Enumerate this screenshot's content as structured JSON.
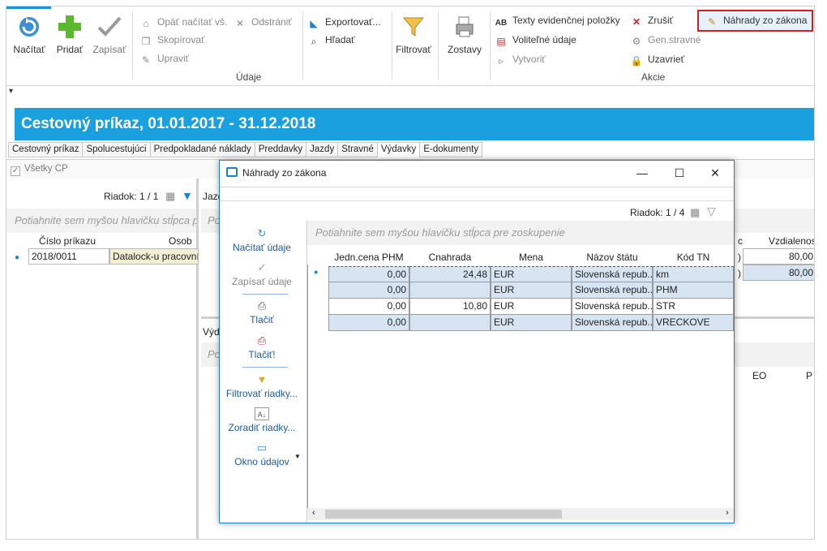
{
  "ribbon": {
    "big_buttons": [
      {
        "label": "Načítať",
        "icon": "reload-icon"
      },
      {
        "label": "Pridať",
        "icon": "add-icon"
      },
      {
        "label": "Zapísať",
        "icon": "check-icon"
      }
    ],
    "data_small": [
      {
        "label": "Opäť načítať vš.",
        "icon": "home-reload-icon",
        "disabled": true
      },
      {
        "label": "Skopírovať",
        "icon": "copy-icon",
        "disabled": true
      },
      {
        "label": "Upraviť",
        "icon": "edit-icon",
        "disabled": true
      },
      {
        "label": "Odstrániť",
        "icon": "delete-icon",
        "disabled": true
      },
      {
        "label": "Exportovať...",
        "icon": "export-icon"
      },
      {
        "label": "Hľadať",
        "icon": "search-icon"
      }
    ],
    "filter_label": "Filtrovať",
    "reports_label": "Zostavy",
    "group_data": "Údaje",
    "actions_small": [
      {
        "label": "Texty evidenčnej položky",
        "icon": "text-ab-icon"
      },
      {
        "label": "Voliteľné údaje",
        "icon": "form-icon"
      },
      {
        "label": "Vytvoriť",
        "icon": "create-icon",
        "disabled": true
      },
      {
        "label": "Zrušiť",
        "icon": "cancel-x-icon"
      },
      {
        "label": "Gen.stravné",
        "icon": "gears-icon",
        "disabled": true
      },
      {
        "label": "Uzavrieť",
        "icon": "lock-icon"
      },
      {
        "label": "Náhrady zo zákona",
        "icon": "pencil-note-icon"
      }
    ],
    "group_actions": "Akcie"
  },
  "quickbar": "▾",
  "page_title": "Cestovný príkaz, 01.01.2017 - 31.12.2018",
  "tabs": [
    "Cestovný príkaz",
    "Spolucestujúci",
    "Predpokladané náklady",
    "Preddavky",
    "Jazdy",
    "Stravné",
    "Výdavky",
    "E-dokumenty"
  ],
  "active_tab": "Výdavky",
  "filter_checkbox": "Všetky CP",
  "left_grid": {
    "riadok": "Riadok: 1 / 1",
    "group_hint": "Potiahnite sem myšou hlavičku stĺpca pre zoskupenie",
    "columns": [
      "Číslo príkazu",
      "Osob"
    ],
    "rows": [
      [
        "2018/0011",
        "Datalock-u pracovník"
      ]
    ]
  },
  "right_bg": {
    "col_partial": "Jazd",
    "hint_partial": "Po",
    "vyd_partial": "Výd",
    "hint_partial2": "Po",
    "header_c": "c",
    "header_vzd": "Vzdialenosť",
    "vzd_values": [
      "80,00",
      "80,00"
    ],
    "paren": ")",
    "eo": "EO",
    "p": "P"
  },
  "dialog": {
    "title": "Náhrady zo zákona",
    "minimize": "—",
    "maximize": "☐",
    "close": "✕",
    "riadok": "Riadok: 1 / 4",
    "side_buttons": [
      {
        "label": "Načítať údaje",
        "icon": "reload-icon"
      },
      {
        "label": "Zapísať údaje",
        "icon": "check-icon",
        "disabled": true
      },
      {
        "label": "Tlačiť",
        "icon": "printer-icon"
      },
      {
        "label": "Tlačiť!",
        "icon": "printer-red-icon"
      },
      {
        "label": "Filtrovať riadky...",
        "icon": "filter-icon"
      },
      {
        "label": "Zoradiť riadky...",
        "icon": "sort-az-icon"
      },
      {
        "label": "Okno údajov",
        "icon": "window-icon"
      }
    ],
    "group_hint": "Potiahnite sem myšou hlavičku stĺpca pre zoskupenie",
    "columns": [
      "Jedn.cena PHM",
      "Cnahrada",
      "Mena",
      "Názov štátu",
      "Kód TN"
    ],
    "rows": [
      [
        "0,00",
        "24,48",
        "EUR",
        "Slovenská repub...",
        "km"
      ],
      [
        "0,00",
        "",
        "EUR",
        "Slovenská repub...",
        "PHM"
      ],
      [
        "0,00",
        "10,80",
        "EUR",
        "Slovenská repub...",
        "STR"
      ],
      [
        "0,00",
        "",
        "EUR",
        "Slovenská repub...",
        "VRECKOVE"
      ]
    ]
  }
}
